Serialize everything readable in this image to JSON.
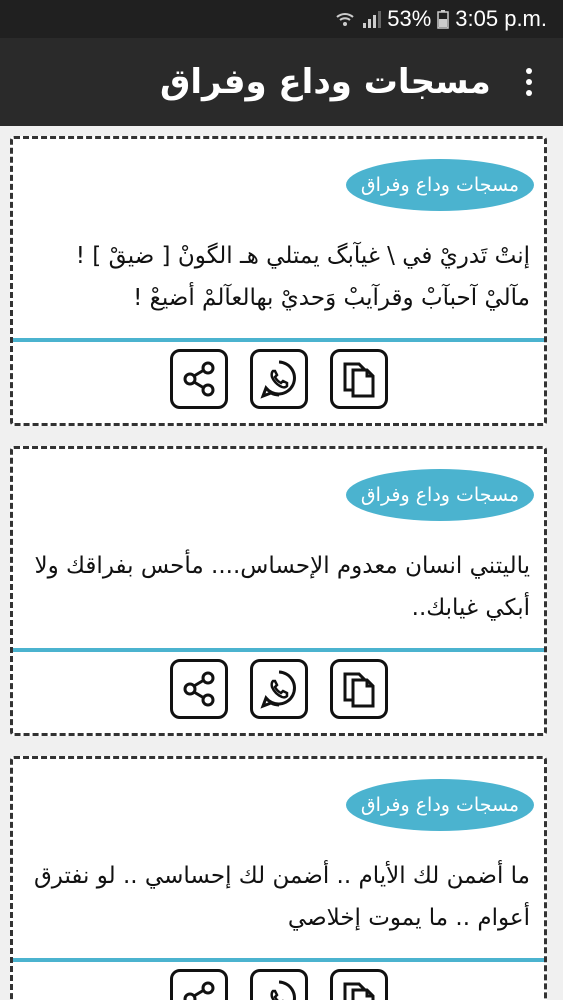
{
  "status_bar": {
    "battery": "53%",
    "time": "3:05 p.m."
  },
  "app_bar": {
    "title": "مسجات وداع وفراق",
    "menu_icon": "overflow-menu-icon"
  },
  "cards": [
    {
      "tag": "مسجات وداع وفراق",
      "text": "إنتْ تَدريْ في \\ غيآبگ يمتلي هـ الگونْ [ ضيقْ ] ! مآليْ آحبآبْ وقرآيبْ وَحديْ بهالعآلمْ أضيعْ !"
    },
    {
      "tag": "مسجات وداع وفراق",
      "text": "ياليتني انسان معدوم الإحساس.... مأحس بفراقك ولا أبكي غيابك.."
    },
    {
      "tag": "مسجات وداع وفراق",
      "text": "ما أضمن لك الأيام .. أضمن لك إحساسي .. لو نفترق أعوام .. ما يموت إخلاصي"
    }
  ],
  "actions": {
    "copy_icon": "copy-icon",
    "whatsapp_icon": "whatsapp-icon",
    "share_icon": "share-icon"
  },
  "colors": {
    "accent": "#4bb3cf",
    "app_bar": "#2a2a2a",
    "status_bar": "#202020"
  }
}
